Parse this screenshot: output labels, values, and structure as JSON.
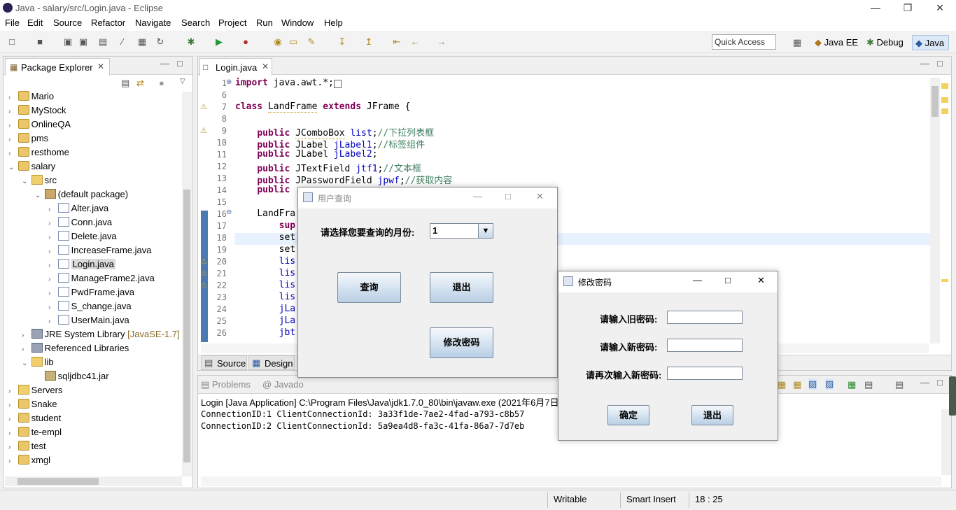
{
  "window": {
    "title": "Java - salary/src/Login.java - Eclipse"
  },
  "menu": [
    "File",
    "Edit",
    "Source",
    "Refactor",
    "Navigate",
    "Search",
    "Project",
    "Run",
    "Window",
    "Help"
  ],
  "toolbar": {
    "quick_access": "Quick Access",
    "perspectives": [
      "Java EE",
      "Debug",
      "Java"
    ]
  },
  "package_explorer": {
    "title": "Package Explorer",
    "items": [
      {
        "label": "Mario"
      },
      {
        "label": "MyStock"
      },
      {
        "label": "OnlineQA"
      },
      {
        "label": "pms"
      },
      {
        "label": "resthome"
      },
      {
        "label": "salary"
      },
      {
        "label": "src"
      },
      {
        "label": "(default package)"
      },
      {
        "label": "Alter.java"
      },
      {
        "label": "Conn.java"
      },
      {
        "label": "Delete.java"
      },
      {
        "label": "IncreaseFrame.java"
      },
      {
        "label": "Login.java"
      },
      {
        "label": "ManageFrame2.java"
      },
      {
        "label": "PwdFrame.java"
      },
      {
        "label": "S_change.java"
      },
      {
        "label": "UserMain.java"
      },
      {
        "label": "JRE System Library",
        "suffix": "[JavaSE-1.7]"
      },
      {
        "label": "Referenced Libraries"
      },
      {
        "label": "lib"
      },
      {
        "label": "sqljdbc41.jar"
      },
      {
        "label": "Servers"
      },
      {
        "label": "Snake"
      },
      {
        "label": "student"
      },
      {
        "label": "te-empl"
      },
      {
        "label": "test"
      },
      {
        "label": "xmgl"
      }
    ]
  },
  "editor": {
    "tab": "Login.java",
    "line_numbers": [
      "1",
      "6",
      "7",
      "8",
      "9",
      "10",
      "11",
      "12",
      "13",
      "14",
      "15",
      "16",
      "17",
      "18",
      "19",
      "20",
      "21",
      "22",
      "23",
      "24",
      "25",
      "26"
    ],
    "lines": {
      "l1": "import java.awt.*;",
      "l7a": "class",
      "l7b": "LandFrame",
      "l7c": "extends",
      "l7d": "JFrame {",
      "l9a": "public",
      "l9b": "JComboBox",
      "l9c": "list",
      "l9d": "//下拉列表框",
      "l10a": "public",
      "l10b": "JLabel",
      "l10c": "jLabel1",
      "l10d": "//标签组件",
      "l11a": "public",
      "l11b": "JLabel",
      "l11c": "jLabel2",
      "l12a": "public",
      "l12b": "JTextField",
      "l12c": "jtf1",
      "l12d": "//文本框",
      "l13a": "public",
      "l13b": "JPasswordField",
      "l13c": "jpwf",
      "l13d": "//获取内容",
      "l14a": "public",
      "l16": "LandFra",
      "l17": "sup",
      "l18": "set",
      "l19": "set",
      "l20": "lis",
      "l21": "lis",
      "l22": "lis",
      "l23": "lis",
      "l24": "jLa",
      "l25": "jLa",
      "l26": "jbt"
    },
    "bottom_tabs": [
      "Source",
      "Design"
    ]
  },
  "console": {
    "tabs": [
      "Problems",
      "Javado"
    ],
    "header": "Login [Java Application] C:\\Program Files\\Java\\jdk1.7.0_80\\bin\\javaw.exe (2021年6月7日",
    "lines": [
      "ConnectionID:1 ClientConnectionId: 3a33f1de-7ae2-4fad-a793-c8b57",
      "ConnectionID:2 ClientConnectionId: 5a9ea4d8-fa3c-41fa-86a7-7d7eb"
    ]
  },
  "status": {
    "writable": "Writable",
    "insert": "Smart Insert",
    "position": "18 : 25"
  },
  "query_dialog": {
    "title": "用户查询",
    "label": "请选择您要查询的月份:",
    "combo_value": "1",
    "query_button": "查询",
    "exit_button": "退出",
    "change_pwd_button": "修改密码"
  },
  "pwd_dialog": {
    "title": "修改密码",
    "old_label": "请输入旧密码:",
    "new_label": "请输入新密码:",
    "again_label": "请再次输入新密码:",
    "ok_button": "确定",
    "exit_button": "退出"
  }
}
